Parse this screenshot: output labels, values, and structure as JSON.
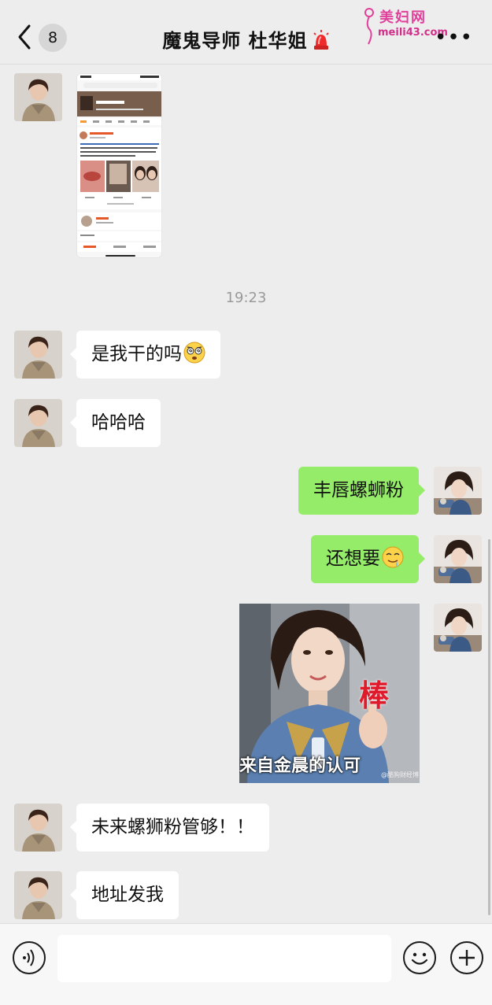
{
  "header": {
    "unread_count": "8",
    "title": "魔鬼导师 杜华姐",
    "watermark_top": "美妇网",
    "watermark_url": "meili43.com"
  },
  "messages": [
    {
      "sender": "them",
      "type": "image",
      "content": "phone screenshot"
    },
    {
      "sender": "them",
      "type": "text",
      "text": "是我干的吗",
      "emoji": "dizzy-face"
    },
    {
      "sender": "them",
      "type": "text",
      "text": "哈哈哈"
    },
    {
      "sender": "me",
      "type": "text",
      "text": "丰唇螺蛳粉"
    },
    {
      "sender": "me",
      "type": "text",
      "text": "还想要",
      "emoji": "drooling-face"
    },
    {
      "sender": "me",
      "type": "sticker",
      "overlay": "棒",
      "caption": "来自金晨的认可",
      "credit": "@酷狗财经博"
    },
    {
      "sender": "them",
      "type": "text",
      "text": "未来螺狮粉管够！！"
    },
    {
      "sender": "them",
      "type": "text",
      "text": "地址发我"
    }
  ],
  "timestamp": "19:23",
  "input": {
    "value": "",
    "placeholder": ""
  },
  "colors": {
    "background": "#ededed",
    "outgoing_bubble": "#95ec69",
    "incoming_bubble": "#ffffff",
    "watermark": "#e0409a"
  },
  "icons": {
    "back": "chevron-left-icon",
    "more": "more-dots-icon",
    "voice": "voice-icon",
    "emoji": "emoji-icon",
    "add": "plus-icon",
    "siren": "siren-icon"
  }
}
